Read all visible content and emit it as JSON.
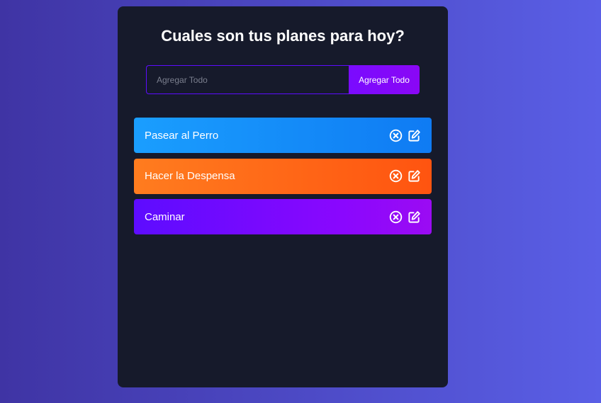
{
  "app": {
    "title": "Cuales son tus planes para hoy?"
  },
  "form": {
    "input_placeholder": "Agregar Todo",
    "input_value": "",
    "add_button_label": "Agregar Todo"
  },
  "todos": [
    {
      "text": "Pasear al Perro",
      "delete_icon": "close-circle-icon",
      "edit_icon": "edit-icon"
    },
    {
      "text": "Hacer la Despensa",
      "delete_icon": "close-circle-icon",
      "edit_icon": "edit-icon"
    },
    {
      "text": "Caminar",
      "delete_icon": "close-circle-icon",
      "edit_icon": "edit-icon"
    }
  ],
  "colors": {
    "page_gradient": [
      "#3f34a4",
      "#5a5fe6"
    ],
    "panel_background": "#161a2b",
    "accent": "#7a0bff",
    "row_blue": "#1a9efe",
    "row_orange": "#ff7c1f",
    "row_purple": "#5d0cff"
  }
}
